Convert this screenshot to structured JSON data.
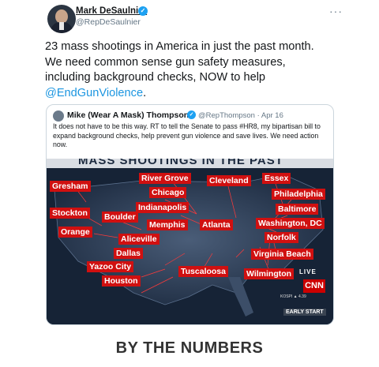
{
  "tweet": {
    "name": "Mark DeSaulnier",
    "handle": "@RepDeSaulnier",
    "more": "···",
    "text_lines": [
      "23 mass shootings in America in just the past month.",
      "We need common sense gun safety measures,",
      "including background checks, NOW to help"
    ],
    "hashtag": "@EndGunViolence",
    "hashtag_suffix": "."
  },
  "quote": {
    "name": "Mike (Wear A Mask) Thompson",
    "handle_date": "@RepThompson · Apr 16",
    "text": "It does not have to be this way. RT to tell the Senate to pass #HR8, my bipartisan bill to expand background checks, help prevent gun violence and save lives. We need action now.",
    "image": {
      "banner": "MASS SHOOTINGS IN THE PAST MONTH",
      "cities": [
        "Gresham",
        "River Grove",
        "Cleveland",
        "Essex",
        "Chicago",
        "Philadelphia",
        "Indianapolis",
        "Baltimore",
        "Stockton",
        "Boulder",
        "Memphis",
        "Atlanta",
        "Washington, DC",
        "Orange",
        "Aliceville",
        "Norfolk",
        "Dallas",
        "Virginia Beach",
        "Yazoo City",
        "Tuscaloosa",
        "Wilmington",
        "Houston"
      ],
      "live": "LIVE",
      "network": "CNN",
      "ticker": "KOSPI ▲ 4.39",
      "corner": "EARLY START"
    }
  },
  "footer": {
    "title": "BY THE NUMBERS"
  }
}
